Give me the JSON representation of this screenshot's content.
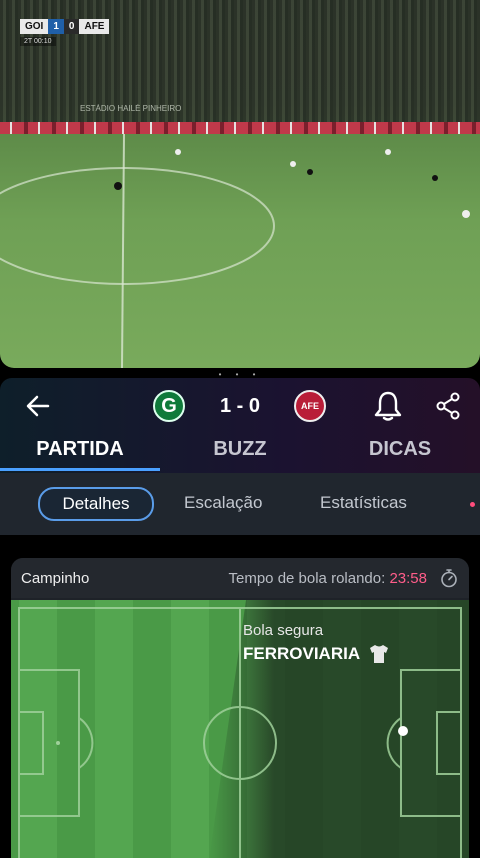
{
  "video": {
    "scorebug": {
      "home": "GOI",
      "home_score": "1",
      "away_score": "0",
      "away": "AFE",
      "clock": "2T 00:10"
    },
    "stadium_text": "ESTÁDIO HAILÉ PINHEIRO"
  },
  "match": {
    "home_crest_letter": "G",
    "score": "1 - 0",
    "away_crest_text": "AFE"
  },
  "tabs": [
    "PARTIDA",
    "BUZZ",
    "DICAS"
  ],
  "subtabs": [
    "Detalhes",
    "Escalação",
    "Estatísticas"
  ],
  "card": {
    "title": "Campinho",
    "timer_label": "Tempo de bola rolando:",
    "timer_value": "23:58",
    "possession_label": "Bola segura",
    "possession_team": "FERROVIARIA"
  },
  "colors": {
    "accent": "#4aa0ff",
    "timer": "#ff5d8a",
    "pitch": "#4a9a47"
  },
  "icons": [
    "back-arrow-icon",
    "bell-icon",
    "share-icon",
    "stopwatch-icon",
    "shirt-icon"
  ]
}
